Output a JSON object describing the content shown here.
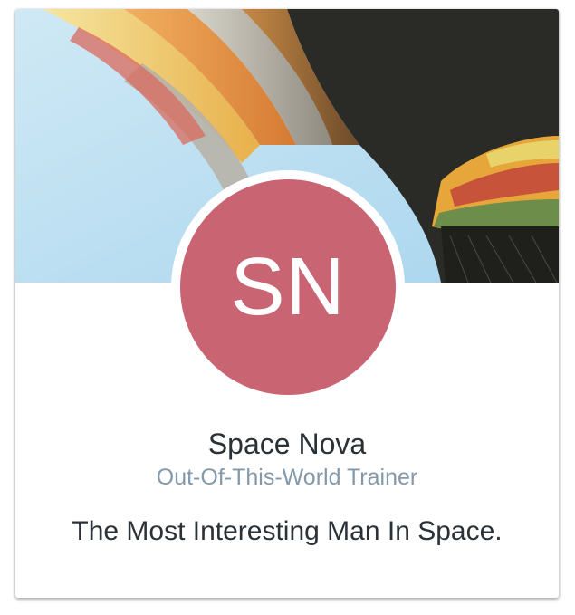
{
  "profile": {
    "initials": "SN",
    "name": "Space Nova",
    "role": "Out-Of-This-World Trainer",
    "tagline": "The Most Interesting Man In Space.",
    "avatar_color": "#c96473"
  },
  "cover": {
    "image": "hot-air-balloon-photo"
  }
}
